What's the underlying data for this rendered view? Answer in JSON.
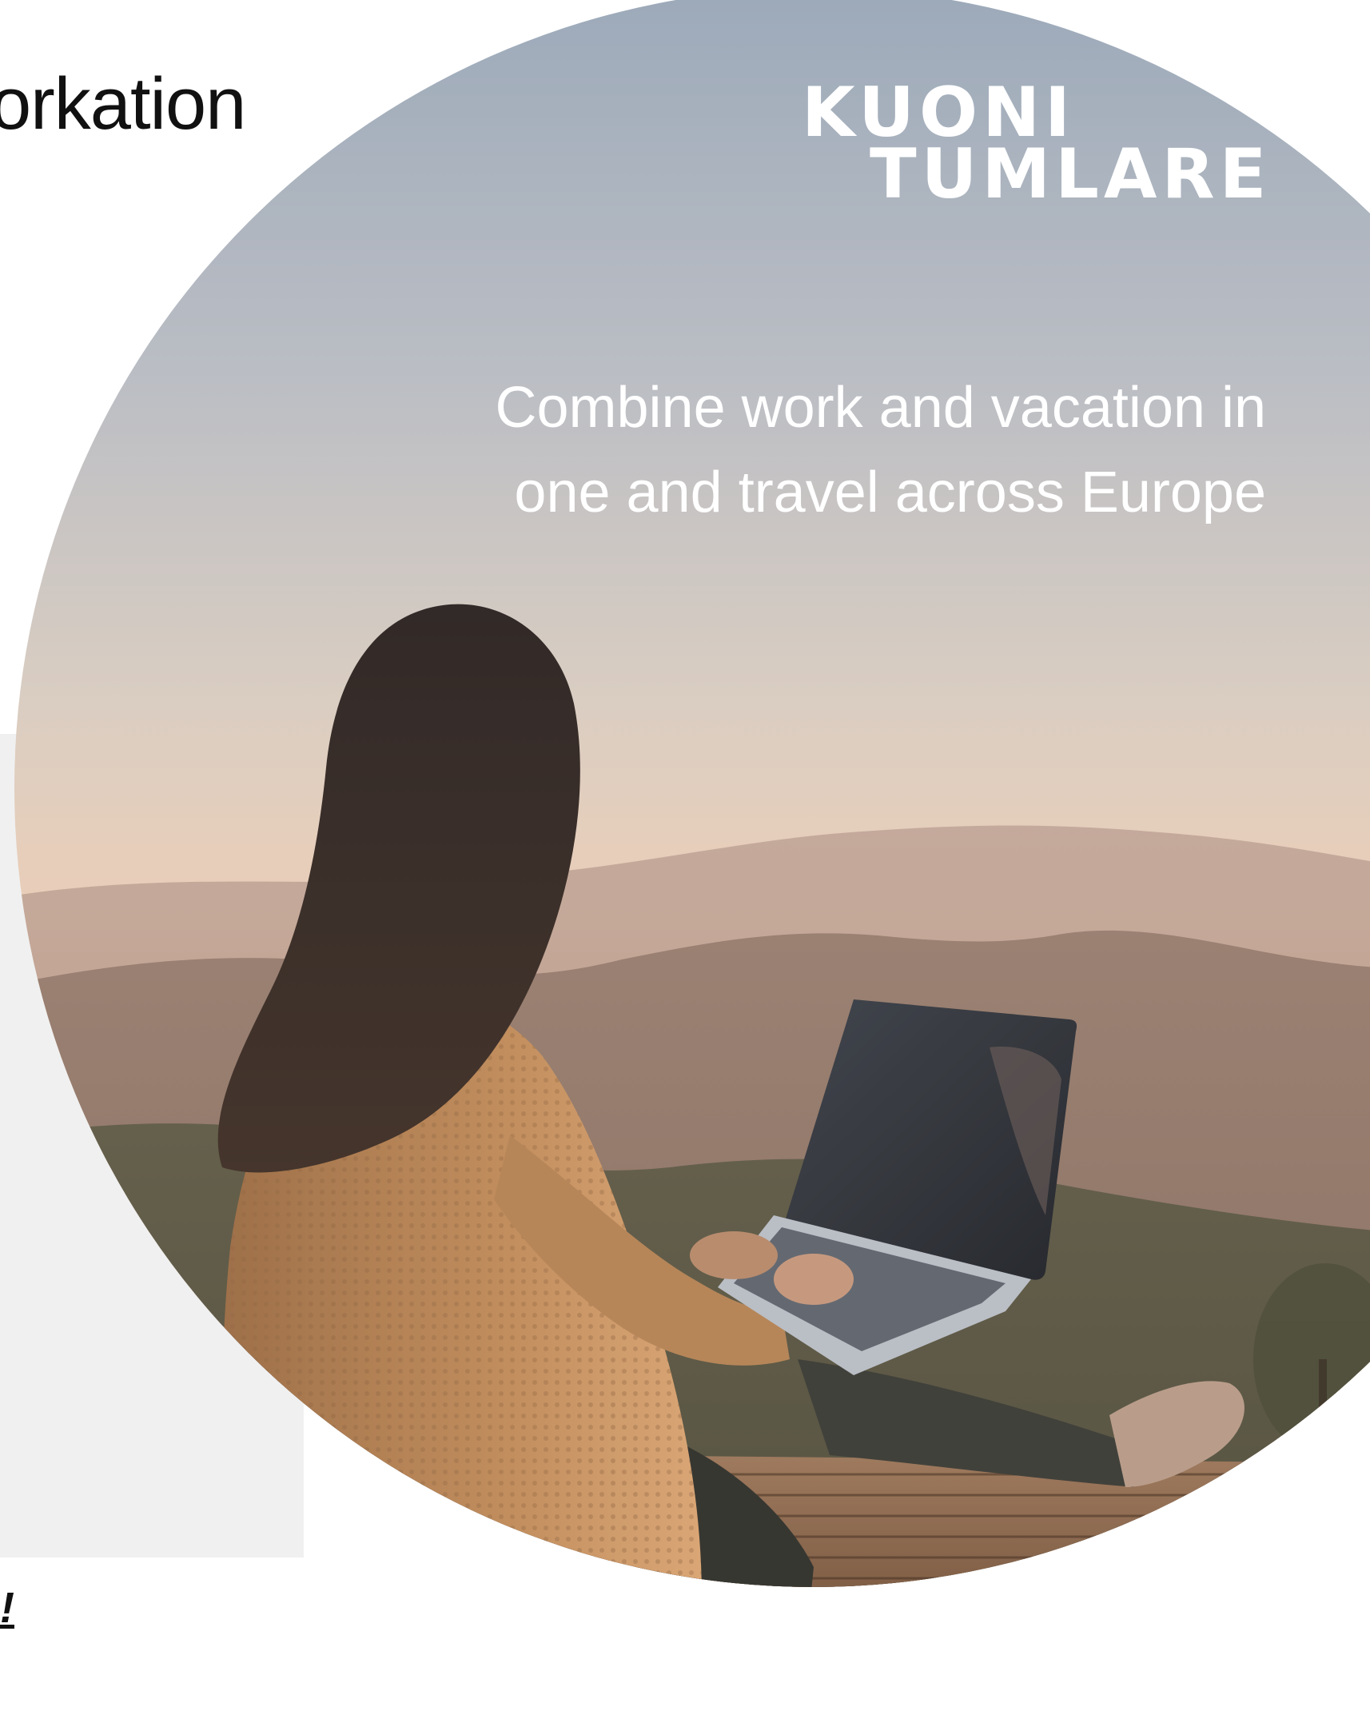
{
  "slide": {
    "title_fragment": "orkation",
    "footer_fragment": "!"
  },
  "hero": {
    "logo": {
      "line1": "KUONI",
      "line2": "TUMLARE"
    },
    "tagline": {
      "line1": "Combine work and vacation in",
      "line2": "one and travel across Europe"
    },
    "image_subject": "woman-working-on-laptop-mountain-view"
  },
  "colors": {
    "sky_top": "#9daabb",
    "sky_mid": "#d9c9bd",
    "horizon": "#e9c9b0",
    "sweater": "#b07d4e",
    "deck": "#7a5637",
    "panel_grey": "#f0f0f0"
  }
}
